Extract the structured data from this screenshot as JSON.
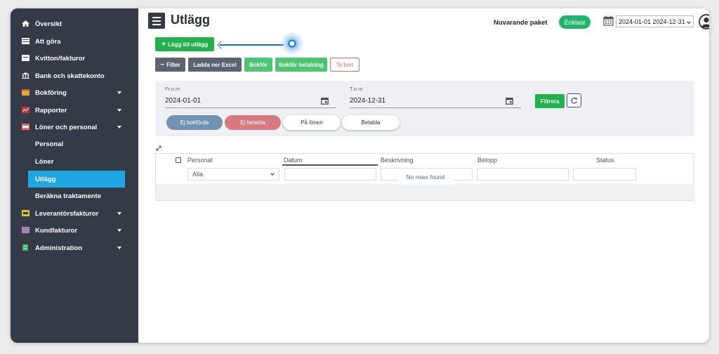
{
  "sidebar": {
    "items": [
      {
        "label": "Översikt",
        "icon": "home-icon"
      },
      {
        "label": "Att göra",
        "icon": "list-icon"
      },
      {
        "label": "Kvitton/fakturor",
        "icon": "receipt-icon"
      },
      {
        "label": "Bank och skattekonto",
        "icon": "bank-icon"
      },
      {
        "label": "Bokföring",
        "icon": "book-icon"
      },
      {
        "label": "Rapporter",
        "icon": "chart-icon"
      },
      {
        "label": "Löner och personal",
        "icon": "wallet-icon"
      },
      {
        "label": "Leverantörsfakturor",
        "icon": "invoice-icon"
      },
      {
        "label": "Kundfakturor",
        "icon": "customer-invoice-icon"
      },
      {
        "label": "Administration",
        "icon": "admin-icon"
      }
    ],
    "sub_items": [
      {
        "label": "Personal"
      },
      {
        "label": "Löner"
      },
      {
        "label": "Utlägg"
      },
      {
        "label": "Beräkna traktamente"
      }
    ]
  },
  "header": {
    "title": "Utlägg",
    "package_label": "Nuvarande paket",
    "package_value": "Enklast",
    "date_range": "2024-01-01 2024-12-31"
  },
  "toolbar": {
    "add_label": "Lägg till utlägg",
    "filter_label": "Filter",
    "excel_label": "Ladda ner Excel",
    "bokfor_label": "Bokför",
    "bokfor_betalning_label": "Bokför betalning",
    "tabort_label": "Ta bort"
  },
  "filter": {
    "from_label": "Fr.o.m",
    "from_value": "2024-01-01",
    "to_label": "T.o.m",
    "to_value": "2024-12-31",
    "apply_label": "Filtrera",
    "chips": [
      "Ej bokförda",
      "Ej betalda",
      "På lönen",
      "Betalda"
    ]
  },
  "table": {
    "columns": [
      "Personal",
      "Datum",
      "Beskrivning",
      "Belopp",
      "Status"
    ],
    "personal_filter": "Alla",
    "empty_message": "No rows found"
  },
  "colors": {
    "sidebar_bg": "#343a46",
    "active": "#1ea7e4",
    "green": "#22b24c",
    "blue_chip": "#7391b3",
    "red_chip": "#d77a80"
  }
}
